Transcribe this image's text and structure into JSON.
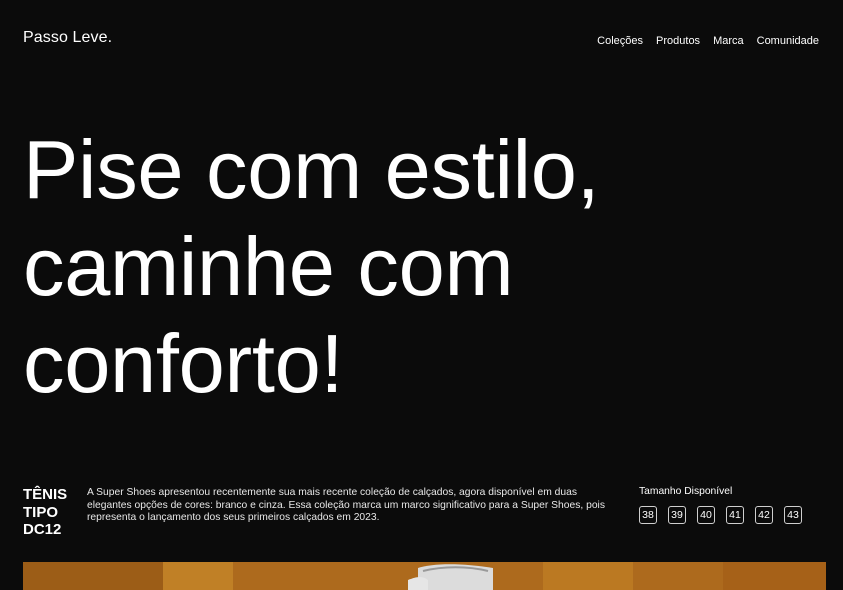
{
  "brand": {
    "name": "Passo Leve."
  },
  "nav": {
    "items": [
      {
        "label": "Coleções"
      },
      {
        "label": "Produtos"
      },
      {
        "label": "Marca"
      },
      {
        "label": "Comunidade"
      }
    ]
  },
  "hero": {
    "lines": [
      "Pise com estilo,",
      "caminhe com",
      "conforto!"
    ]
  },
  "product": {
    "name_lines": [
      "TÊNIS",
      "TIPO",
      "DC12"
    ],
    "description": "A Super Shoes apresentou recentemente sua mais recente coleção de calçados, agora disponível em duas elegantes opções de cores: branco e cinza. Essa coleção marca um marco significativo para a Super Shoes, pois representa o lançamento dos seus primeiros calçados em 2023.",
    "sizes_label": "Tamanho Disponível",
    "sizes": [
      "38",
      "39",
      "40",
      "41",
      "42",
      "43"
    ]
  },
  "colors": {
    "background": "#0b0b0b",
    "text": "#ffffff",
    "image_tone": "#b4701f"
  }
}
